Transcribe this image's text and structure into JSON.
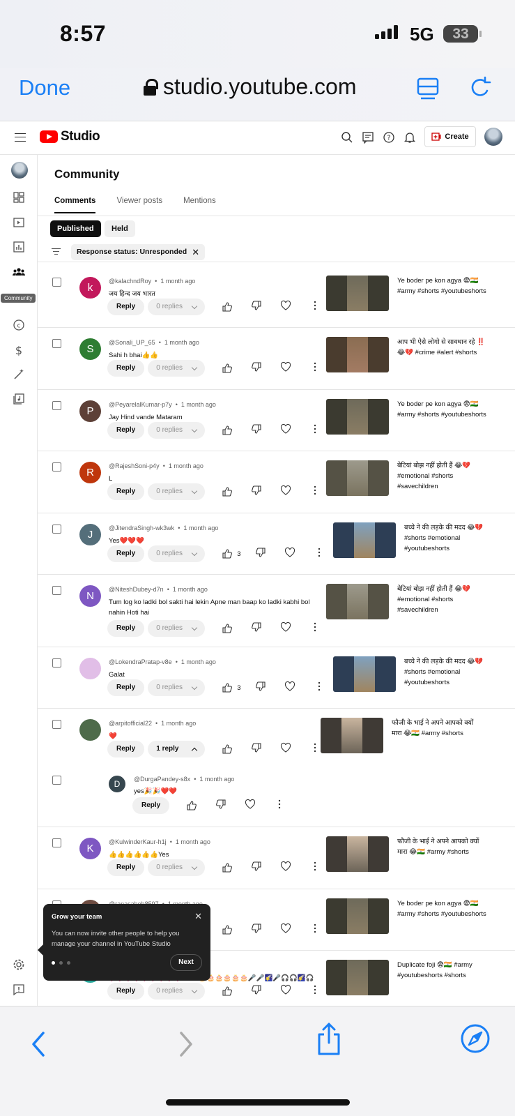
{
  "status_bar": {
    "time": "8:57",
    "network": "5G",
    "battery": "33"
  },
  "browser": {
    "done_label": "Done",
    "url": "studio.youtube.com"
  },
  "header": {
    "logo_text": "Studio",
    "create_label": "Create"
  },
  "sidebar": {
    "tooltip": "Community"
  },
  "page": {
    "title": "Community",
    "tabs": [
      {
        "label": "Comments"
      },
      {
        "label": "Viewer posts"
      },
      {
        "label": "Mentions"
      }
    ],
    "chips": {
      "published": "Published",
      "held": "Held"
    },
    "filter": "Response status: Unresponded"
  },
  "comments": [
    {
      "initial": "k",
      "color": "#c2185b",
      "author": "@kalachndRoy",
      "time": "1 month ago",
      "text": "जय हिन्द जय भारत",
      "reply": "Reply",
      "replies": "0 replies",
      "likes": "",
      "video_title": "Ye boder pe kon agya 😨🇮🇳 #army #shorts #youtubeshorts"
    },
    {
      "initial": "S",
      "color": "#2e7d32",
      "author": "@Sonali_UP_65",
      "time": "1 month ago",
      "text": "Sahi h bhai👍👍",
      "reply": "Reply",
      "replies": "0 replies",
      "likes": "",
      "video_title": "आप भी ऐसे लोगो से सावधान रहे ‼️😂💔 #crime #alert #shorts"
    },
    {
      "initial": "P",
      "color": "#5d4037",
      "author": "@PeyarelalKumar-p7y",
      "time": "1 month ago",
      "text": "Jay Hind vande Mataram",
      "reply": "Reply",
      "replies": "0 replies",
      "likes": "",
      "video_title": "Ye boder pe kon agya 😨🇮🇳 #army #shorts #youtubeshorts"
    },
    {
      "initial": "R",
      "color": "#bf360c",
      "author": "@RajeshSoni-p4y",
      "time": "1 month ago",
      "text": "L",
      "reply": "Reply",
      "replies": "0 replies",
      "likes": "",
      "video_title": "बेटियां बोझ नहीं होती हैं 😂💔 #emotional #shorts #savechildren"
    },
    {
      "initial": "J",
      "color": "#546e7a",
      "author": "@JitendraSingh-wk3wk",
      "time": "1 month ago",
      "text": "Yes❤️❤️❤️",
      "reply": "Reply",
      "replies": "0 replies",
      "likes": "3",
      "video_title": "बच्चे ने की लड़के की मदद 😂💔 #shorts #emotional #youtubeshorts"
    },
    {
      "initial": "N",
      "color": "#7e57c2",
      "author": "@NiteshDubey-d7n",
      "time": "1 month ago",
      "text": "Tum log ko ladki bol sakti hai lekin Apne man baap ko ladki kabhi bol nahin Hoti hai",
      "reply": "Reply",
      "replies": "0 replies",
      "likes": "",
      "video_title": "बेटियां बोझ नहीं होती हैं 😂💔 #emotional #shorts #savechildren"
    },
    {
      "initial": "",
      "color": "#e1bee7",
      "author": "@LokendraPratap-v8e",
      "time": "1 month ago",
      "text": "Galat",
      "reply": "Reply",
      "replies": "0 replies",
      "likes": "3",
      "video_title": "बच्चे ने की लड़के की मदद 😂💔 #shorts #emotional #youtubeshorts"
    },
    {
      "initial": "",
      "color": "#4e6b4a",
      "author": "@arpitofficial22",
      "time": "1 month ago",
      "text": "❤️",
      "reply": "Reply",
      "replies": "1 reply",
      "likes": "",
      "video_title": "फौजी के भाई ने अपने आपको क्यों मारा 😂🇮🇳 #army #shorts"
    },
    {
      "initial": "K",
      "color": "#7e57c2",
      "author": "@KulwinderKaur-h1j",
      "time": "1 month ago",
      "text": "👍👍👍👍👍👍Yes",
      "reply": "Reply",
      "replies": "0 replies",
      "likes": "",
      "video_title": "फौजी के भाई ने अपने आपको क्यों मारा 😂🇮🇳 #army #shorts"
    },
    {
      "initial": "",
      "color": "#6d4c41",
      "author": "@ranasaheb8597",
      "time": "1 month ago",
      "text": "",
      "reply": "Reply",
      "replies": "0 replies",
      "likes": "",
      "video_title": "Ye boder pe kon agya 😨🇮🇳 #army #shorts #youtubeshorts"
    },
    {
      "initial": "",
      "color": "#26a69a",
      "author": "",
      "time": "ago",
      "text": "💞💞💞💞💞💞💞💞💞😊😊 🎂🎂🎂🎂🎂🎂🎤🎤🌠🎤🎧🎧🌠🎧🎤",
      "reply": "Reply",
      "replies": "0 replies",
      "likes": "",
      "video_title": "Duplicate foji 😨🇮🇳 #army #youtubeshorts #shorts"
    }
  ],
  "nested_reply": {
    "initial": "D",
    "color": "#37474f",
    "author": "@DurgaPandey-s8x",
    "time": "1 month ago",
    "text": "yes🎉🎉❤️❤️",
    "reply": "Reply"
  },
  "popup": {
    "title": "Grow your team",
    "text": "You can now invite other people to help you manage your channel in YouTube Studio",
    "next": "Next"
  }
}
